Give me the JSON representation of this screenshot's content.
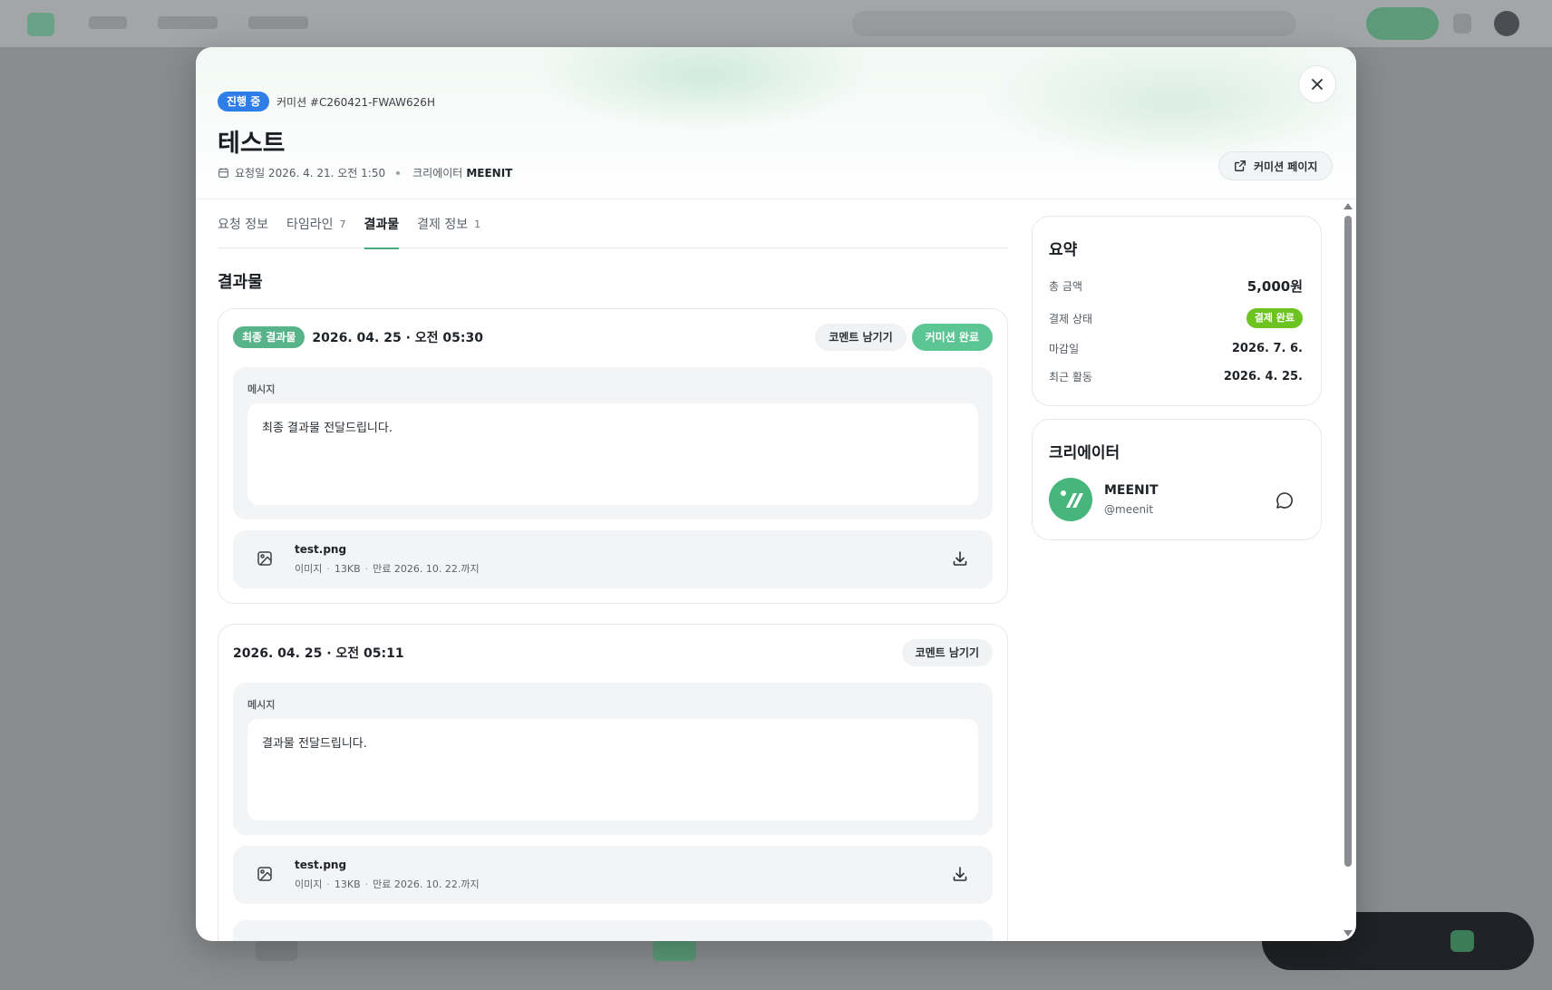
{
  "header": {
    "status": "진행 중",
    "commission_id": "커미션 #C260421-FWAW626H",
    "title": "테스트",
    "requested_at": "요청일 2026. 4. 21. 오전 1:50",
    "creator_label": "크리에이터",
    "creator_name": "MEENIT",
    "page_button": "커미션 페이지"
  },
  "tabs": [
    {
      "label": "요청 정보",
      "count": ""
    },
    {
      "label": "타임라인",
      "count": "7"
    },
    {
      "label": "결과물",
      "count": ""
    },
    {
      "label": "결제 정보",
      "count": "1"
    }
  ],
  "section_title": "결과물",
  "deliverables": [
    {
      "final_badge": "최종 결과물",
      "date": "2026. 04. 25 · 오전 05:30",
      "comment_button": "코멘트 남기기",
      "complete_button": "커미션 완료",
      "message_label": "메시지",
      "message": "최종 결과물 전달드립니다.",
      "file": {
        "name": "test.png",
        "type": "이미지",
        "size": "13KB",
        "expiry": "만료 2026. 10. 22.까지"
      }
    },
    {
      "date": "2026. 04. 25 · 오전 05:11",
      "comment_button": "코멘트 남기기",
      "message_label": "메시지",
      "message": "결과물 전달드립니다.",
      "file": {
        "name": "test.png",
        "type": "이미지",
        "size": "13KB",
        "expiry": "만료 2026. 10. 22.까지"
      }
    }
  ],
  "summary": {
    "title": "요약",
    "rows": [
      {
        "label": "총 금액",
        "value": "5,000원"
      },
      {
        "label": "결제 상태",
        "value": "결제 완료"
      },
      {
        "label": "마감일",
        "value": "2026. 7. 6."
      },
      {
        "label": "최근 활동",
        "value": "2026. 4. 25."
      }
    ]
  },
  "creator": {
    "title": "크리에이터",
    "name": "MEENIT",
    "handle": "@meenit"
  },
  "colors": {
    "accent": "#4aa87d",
    "status_blue": "#2f7ee8",
    "paid_green": "#6dc421",
    "complete_green": "#5cc594"
  },
  "icons": [
    "close-icon",
    "external-link-icon",
    "calendar-icon",
    "image-file-icon",
    "download-icon",
    "chat-icon"
  ]
}
